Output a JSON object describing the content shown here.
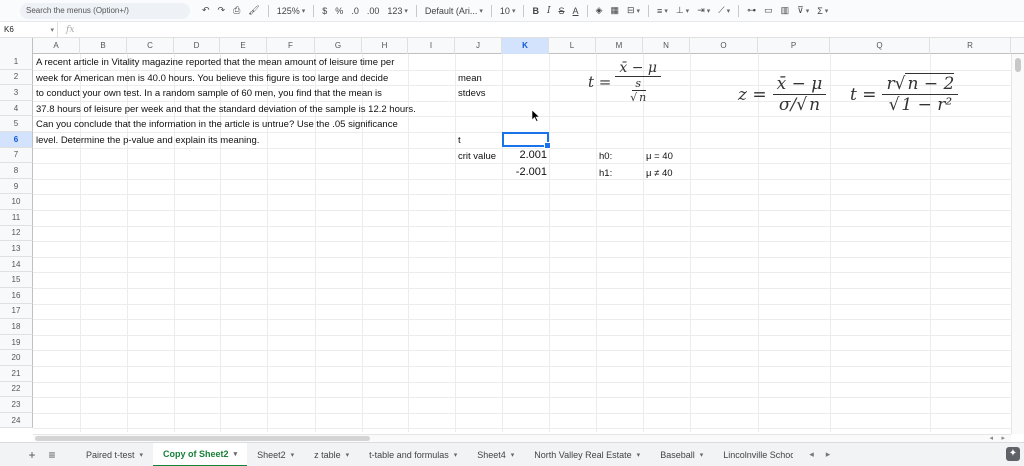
{
  "toolbar": {
    "search_placeholder": "Search the menus (Option+/)",
    "undo": "↶",
    "redo": "↷",
    "print": "⎙",
    "paint_format": "🖌",
    "zoom": "125%",
    "currency": "$",
    "percent": "%",
    "dec_decrease": ".0",
    "dec_increase": ".00",
    "more_formats": "123",
    "font": "Default (Ari...",
    "font_size": "10",
    "bold": "B",
    "italic": "I",
    "strike": "S",
    "text_color": "A",
    "sum": "Σ"
  },
  "formula_bar": {
    "name_box": "K6",
    "fx": "fx",
    "content": ""
  },
  "columns": [
    "A",
    "B",
    "C",
    "D",
    "E",
    "F",
    "G",
    "H",
    "I",
    "J",
    "K",
    "L",
    "M",
    "N",
    "O",
    "P",
    "Q",
    "R"
  ],
  "rows": [
    "1",
    "2",
    "3",
    "4",
    "5",
    "6",
    "7",
    "8",
    "9",
    "10",
    "11",
    "12",
    "13",
    "14",
    "15",
    "16",
    "17",
    "18",
    "19",
    "20",
    "21",
    "22",
    "23",
    "24"
  ],
  "cells": {
    "a1": "A recent article in Vitality magazine reported that the mean amount of leisure time per",
    "a2": "week for American men is 40.0 hours. You believe this figure is too large and decide",
    "a3": "to conduct your own test. In a random sample of 60 men, you find that the mean is",
    "a4": "37.8 hours of leisure per week and that the standard deviation of the sample is 12.2 hours.",
    "a5": "Can you conclude that the information in the article is untrue? Use the .05 significance",
    "a6": "level. Determine the p-value and explain its meaning.",
    "j2": "mean",
    "j3": "stdevs",
    "j6": "t",
    "j7": "crit value",
    "k7": "2.001",
    "k8": "-2.001",
    "m7": "h0:",
    "n7": "μ = 40",
    "m8": "h1:",
    "n8": "μ ≠ 40"
  },
  "formulas": {
    "t_lhs": "t =",
    "t_num": "x̄ − μ",
    "t_den_top": "s",
    "t_den_bottom": "n",
    "z_lhs": "z =",
    "z_num": "x̄ − μ",
    "z_den": "σ/",
    "z_den_root": "n",
    "r_lhs": "t =",
    "r_num_coef": "r",
    "r_num_root": "n − 2",
    "r_den_root": "1 − r²"
  },
  "tabs": [
    {
      "label": "Paired t-test"
    },
    {
      "label": "Copy of Sheet2"
    },
    {
      "label": "Sheet2"
    },
    {
      "label": "z table"
    },
    {
      "label": "t-table and formulas"
    },
    {
      "label": "Sheet4"
    },
    {
      "label": "North Valley Real Estate"
    },
    {
      "label": "Baseball"
    },
    {
      "label": "Lincolnville Schoo"
    }
  ],
  "tab_buttons": {
    "add": "+",
    "all_sheets": "≡",
    "prev": "◂",
    "next": "▸"
  }
}
